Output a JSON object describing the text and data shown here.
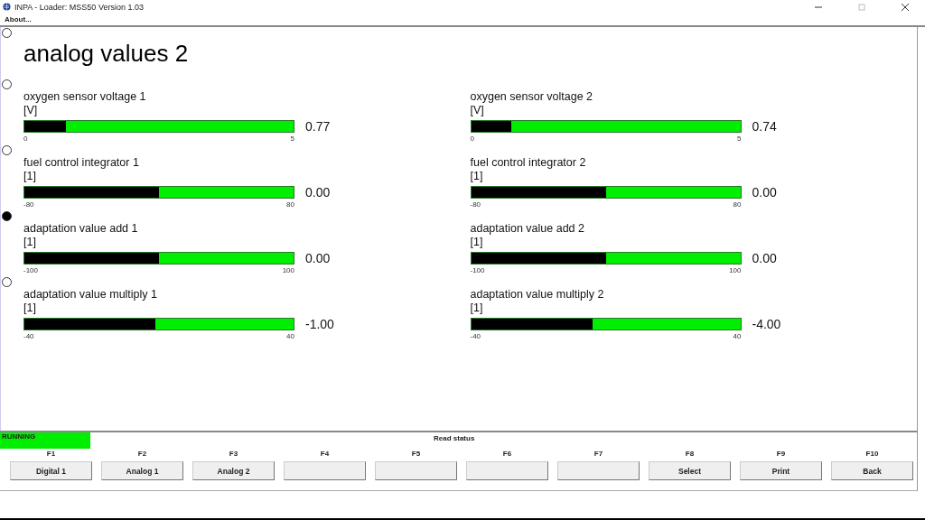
{
  "window": {
    "title": "INPA - Loader:  MSS50 Version 1.03"
  },
  "menu": [
    "About..."
  ],
  "heading": "analog values 2",
  "selectors": [
    {
      "selected": false
    },
    {
      "selected": false
    },
    {
      "selected": false
    },
    {
      "selected": true
    },
    {
      "selected": false
    }
  ],
  "gauge_rows": [
    [
      {
        "name": "oxygen sensor voltage  1",
        "unit": "[V]",
        "min": "0",
        "max": "5",
        "value": "0.77",
        "level": 0.154
      },
      {
        "name": "oxygen sensor voltage  2",
        "unit": "[V]",
        "min": "0",
        "max": "5",
        "value": "0.74",
        "level": 0.148
      }
    ],
    [
      {
        "name": "fuel control integrator 1",
        "unit": "[1]",
        "min": "-80",
        "max": "80",
        "value": "0.00",
        "level": 0.5
      },
      {
        "name": "fuel control integrator 2",
        "unit": "[1]",
        "min": "-80",
        "max": "80",
        "value": "0.00",
        "level": 0.5
      }
    ],
    [
      {
        "name": "adaptation value add 1",
        "unit": "[1]",
        "min": "-100",
        "max": "100",
        "value": "0.00",
        "level": 0.5
      },
      {
        "name": "adaptation value add 2",
        "unit": "[1]",
        "min": "-100",
        "max": "100",
        "value": "0.00",
        "level": 0.5
      }
    ],
    [
      {
        "name": "adaptation value multiply 1",
        "unit": "[1]",
        "min": "-40",
        "max": "40",
        "value": "-1.00",
        "level": 0.4875
      },
      {
        "name": "adaptation value multiply 2",
        "unit": "[1]",
        "min": "-40",
        "max": "40",
        "value": "-4.00",
        "level": 0.45
      }
    ]
  ],
  "status_bar": {
    "state": "RUNNING",
    "message": "Read status"
  },
  "function_keys": [
    {
      "key": "F1",
      "label": "Digital 1"
    },
    {
      "key": "F2",
      "label": "Analog 1"
    },
    {
      "key": "F3",
      "label": "Analog 2"
    },
    {
      "key": "F4"
    },
    {
      "key": "F5"
    },
    {
      "key": "F6"
    },
    {
      "key": "F7"
    },
    {
      "key": "F8",
      "label": "Select"
    },
    {
      "key": "F9",
      "label": "Print"
    },
    {
      "key": "F10",
      "label": "Back"
    }
  ]
}
